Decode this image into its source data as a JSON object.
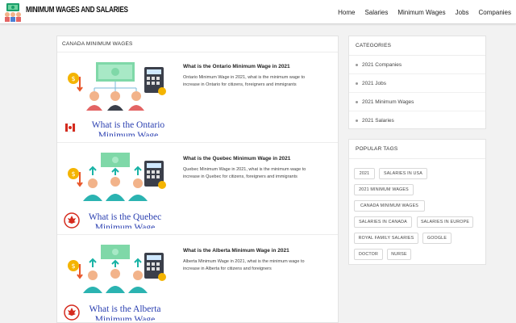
{
  "site": {
    "logo_text": "MINIMUM WAGES AND SALARIES",
    "nav": [
      "Home",
      "Salaries",
      "Minimum Wages",
      "Jobs",
      "Companies"
    ]
  },
  "main": {
    "section_title": "CANADA MINIMUM WAGES",
    "posts": [
      {
        "title": "What is the Ontario Minimum Wage in 2021",
        "excerpt": "Ontario Minimum Wage in 2021, what is the minimum wage to increase in Ontario for citizens, foreigners and immigrants",
        "thumb_caption": "What is the Ontario Minimum Wage"
      },
      {
        "title": "What is the Quebec Minimum Wage in 2021",
        "excerpt": "Quebec Minimum Wage in 2021, what is the minimum wage to increase in Quebec for citizens, foreigners and immigrants",
        "thumb_caption": "What is the Quebec Minimum Wage"
      },
      {
        "title": "What is the Alberta Minimum Wage in 2021",
        "excerpt": "Alberta Minimum Wage in 2021, what is the minimum wage to increase in Alberta for citizens and foreigners",
        "thumb_caption": "What is the Alberta Minimum Wage"
      }
    ]
  },
  "sidebar": {
    "categories_title": "CATEGORIES",
    "categories": [
      "2021 Companies",
      "2021 Jobs",
      "2021 Minimum Wages",
      "2021 Salaries"
    ],
    "tags_title": "POPULAR TAGS",
    "tags": [
      "2021",
      "SALARIES IN USA",
      "2021 MINIMUM WAGES",
      "CANADA MINIMUM WAGES",
      "SALARIES IN CANADA",
      "SALARIES IN EUROPE",
      "ROYAL FAMILY SALARIES",
      "GOOGLE",
      "DOCTOR",
      "NURSE"
    ]
  },
  "colors": {
    "caption_blue": "#2a3fb0",
    "money_green": "#7fd8a8",
    "coin_gold": "#f4b400",
    "arrow_red": "#e8562a",
    "arrow_teal": "#19b3a6",
    "person_teal": "#2bb3b1",
    "maple_red": "#d52b1e"
  },
  "icons": [
    "logo-icon",
    "money-bill-icon",
    "coin-icon",
    "calculator-icon",
    "people-icon",
    "canada-flag-icon",
    "maple-leaf-icon"
  ]
}
